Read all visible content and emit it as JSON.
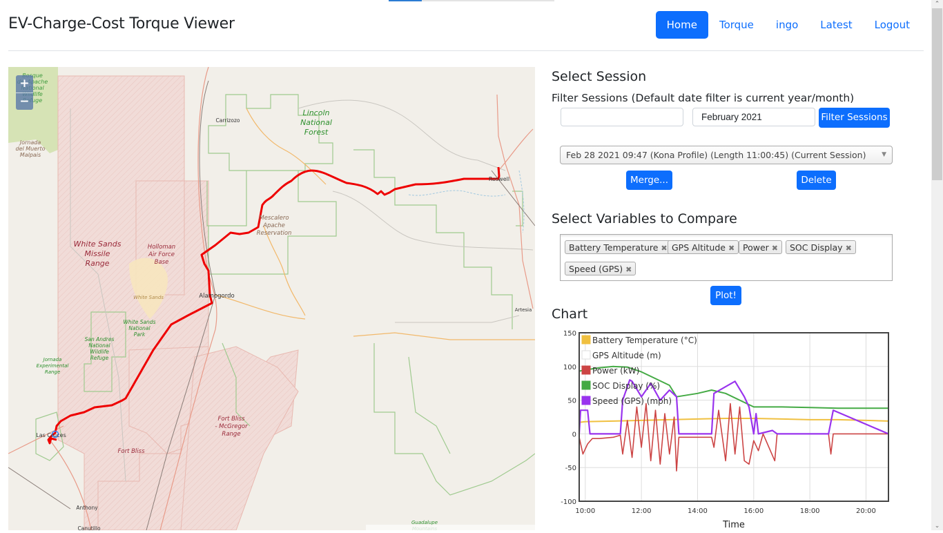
{
  "header": {
    "title": "EV-Charge-Cost Torque Viewer",
    "nav": [
      {
        "label": "Home",
        "active": true
      },
      {
        "label": "Torque",
        "active": false
      },
      {
        "label": "ingo",
        "active": false
      },
      {
        "label": "Latest",
        "active": false
      },
      {
        "label": "Logout",
        "active": false
      }
    ]
  },
  "map": {
    "zoom_in": "+",
    "zoom_out": "−",
    "labels": {
      "bosque": [
        "Bosque",
        "del Apache",
        "National",
        "Wildlife",
        "Refuge"
      ],
      "jornada_malpais": [
        "Jornada",
        "del Muerto",
        "Malpais"
      ],
      "carrizozo": "Carrizozo",
      "lincoln": [
        "Lincoln",
        "National",
        "Forest"
      ],
      "roswell": "Roswell",
      "mescalero": [
        "Mescalero",
        "Apache",
        "Reservation"
      ],
      "wsmr": [
        "White Sands",
        "Missile",
        "Range"
      ],
      "holloman": [
        "Holloman",
        "Air Force",
        "Base"
      ],
      "white_sands": "White Sands",
      "alamogordo": "Alamogordo",
      "artesia": "Artesia",
      "wsnp": [
        "White Sands",
        "National",
        "Park"
      ],
      "san_andres": [
        "San Andres",
        "National",
        "Wildlife",
        "Refuge"
      ],
      "jornada_exp": [
        "Jornada",
        "Experimental",
        "Range"
      ],
      "las_cruces": "Las Cruces",
      "fort_bliss": "Fort Bliss",
      "mcgregor": [
        "Fort Bliss",
        "- McGregor",
        "Range"
      ],
      "anthony": "Anthony",
      "canutillo": "Canutillo",
      "guadalupe": [
        "Guadalupe",
        "Mountains"
      ]
    }
  },
  "session": {
    "heading": "Select Session",
    "filter_label": "Filter Sessions (Default date filter is current year/month)",
    "filter_text_value": "",
    "filter_date_value": "February 2021",
    "filter_button": "Filter Sessions",
    "selected_session": "Feb 28 2021 09:47 (Kona Profile) (Length 11:00:45) (Current Session)",
    "merge_button": "Merge...",
    "delete_button": "Delete"
  },
  "variables": {
    "heading": "Select Variables to Compare",
    "selected": [
      "Battery Temperature",
      "GPS Altitude",
      "Power",
      "SOC Display",
      "Speed (GPS)"
    ],
    "remove_glyph": "✖",
    "plot_button": "Plot!"
  },
  "chart_heading": "Chart",
  "chart_data": {
    "type": "line",
    "title": "",
    "xlabel": "Time",
    "ylabel": "",
    "xlim": [
      "09:47",
      "20:48"
    ],
    "ylim": [
      -100,
      150
    ],
    "x_ticks": [
      "10:00",
      "12:00",
      "14:00",
      "16:00",
      "18:00",
      "20:00"
    ],
    "y_ticks": [
      150,
      100,
      50,
      0,
      -50,
      -100
    ],
    "grid": true,
    "legend_position": "top-left",
    "series": [
      {
        "name": "Battery Temperature (°C)",
        "color": "#f0c040",
        "x": [
          "09:47",
          "10:00",
          "11:00",
          "12:00",
          "13:00",
          "14:00",
          "15:00",
          "16:00",
          "17:00",
          "18:00",
          "19:00",
          "20:00",
          "20:48"
        ],
        "values": [
          17,
          18,
          19,
          20,
          21,
          22,
          23,
          23,
          22,
          21,
          21,
          20,
          19
        ]
      },
      {
        "name": "GPS Altitude (m)",
        "color": "#ffffff",
        "x": [],
        "values": []
      },
      {
        "name": "Power (kW)",
        "color": "#cc4444",
        "x": [
          "09:47",
          "09:55",
          "10:05",
          "10:15",
          "10:30",
          "11:00",
          "11:15",
          "11:20",
          "11:30",
          "11:40",
          "11:50",
          "12:00",
          "12:10",
          "12:20",
          "12:30",
          "12:40",
          "12:50",
          "13:00",
          "13:10",
          "13:15",
          "13:20",
          "14:00",
          "14:30",
          "14:35",
          "14:45",
          "15:00",
          "15:10",
          "15:20",
          "15:30",
          "15:40",
          "15:50",
          "16:00",
          "16:10",
          "16:20",
          "16:45",
          "16:50",
          "18:40",
          "18:45",
          "18:50",
          "20:48"
        ],
        "values": [
          -5,
          -30,
          -15,
          -7,
          -7,
          -5,
          -2,
          -30,
          20,
          -35,
          40,
          -20,
          45,
          -40,
          35,
          -45,
          30,
          -30,
          25,
          -55,
          -5,
          -5,
          -5,
          -20,
          35,
          -40,
          45,
          -30,
          40,
          -40,
          -45,
          -10,
          -25,
          0,
          -40,
          0,
          0,
          -30,
          0,
          0
        ]
      },
      {
        "name": "SOC Display (%)",
        "color": "#44aa44",
        "x": [
          "09:47",
          "10:00",
          "10:30",
          "11:00",
          "11:30",
          "12:00",
          "12:30",
          "13:00",
          "13:15",
          "14:00",
          "14:30",
          "15:00",
          "15:30",
          "16:00",
          "17:00",
          "18:00",
          "19:00",
          "20:00",
          "20:48"
        ],
        "values": [
          93,
          95,
          98,
          100,
          99,
          92,
          82,
          72,
          55,
          60,
          65,
          60,
          50,
          40,
          40,
          39,
          38,
          38,
          38
        ]
      },
      {
        "name": "Speed (GPS) (mph)",
        "color": "#9933ee",
        "x": [
          "09:47",
          "09:50",
          "10:05",
          "10:10",
          "11:15",
          "11:20",
          "11:35",
          "11:40",
          "12:00",
          "12:20",
          "12:40",
          "13:00",
          "13:15",
          "13:20",
          "14:30",
          "14:35",
          "15:00",
          "15:20",
          "15:40",
          "15:50",
          "16:00",
          "16:05",
          "16:10",
          "16:40",
          "16:50",
          "18:40",
          "18:50",
          "20:48"
        ],
        "values": [
          0,
          35,
          35,
          0,
          0,
          50,
          80,
          78,
          55,
          75,
          50,
          65,
          55,
          0,
          0,
          60,
          70,
          78,
          55,
          40,
          0,
          30,
          0,
          5,
          0,
          0,
          35,
          0
        ]
      }
    ]
  }
}
